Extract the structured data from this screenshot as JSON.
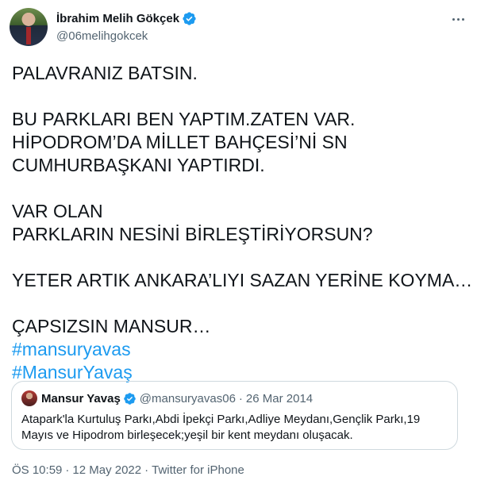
{
  "author": {
    "name": "İbrahim Melih Gökçek",
    "handle": "@06melihgokcek",
    "verified_icon": "verified-badge-icon"
  },
  "tweet": {
    "lines": [
      "PALAVRANIZ BATSIN.",
      "",
      "BU PARKLARI BEN YAPTIM.ZATEN VAR.",
      "HİPODROM’DA MİLLET BAHÇESİ’Nİ SN",
      "CUMHURBAŞKANI YAPTIRDI.",
      "",
      "VAR OLAN",
      "PARKLARIN NESİNİ BİRLEŞTİRİYORSUN?",
      "",
      "YETER ARTIK ANKARA’LIYI SAZAN YERİNE KOYMA…",
      "",
      "ÇAPSIZSIN MANSUR…"
    ],
    "hashtags": [
      "#mansuryavas",
      "#MansurYavaş"
    ]
  },
  "quoted_tweet": {
    "name": "Mansur Yavaş",
    "handle": "@mansuryavas06",
    "separator": "·",
    "date": "26 Mar 2014",
    "text": "Atapark'la Kurtuluş Parkı,Abdi İpekçi Parkı,Adliye Meydanı,Gençlik Parkı,19 Mayıs ve Hipodrom birleşecek;yeşil bir kent meydanı oluşacak."
  },
  "meta": {
    "time": "ÖS 10:59",
    "separator": "·",
    "date": "12 May 2022",
    "source": "Twitter for iPhone"
  },
  "colors": {
    "text": "#0f1419",
    "secondary": "#536471",
    "accent": "#1d9bf0",
    "border": "#cfd9de"
  }
}
